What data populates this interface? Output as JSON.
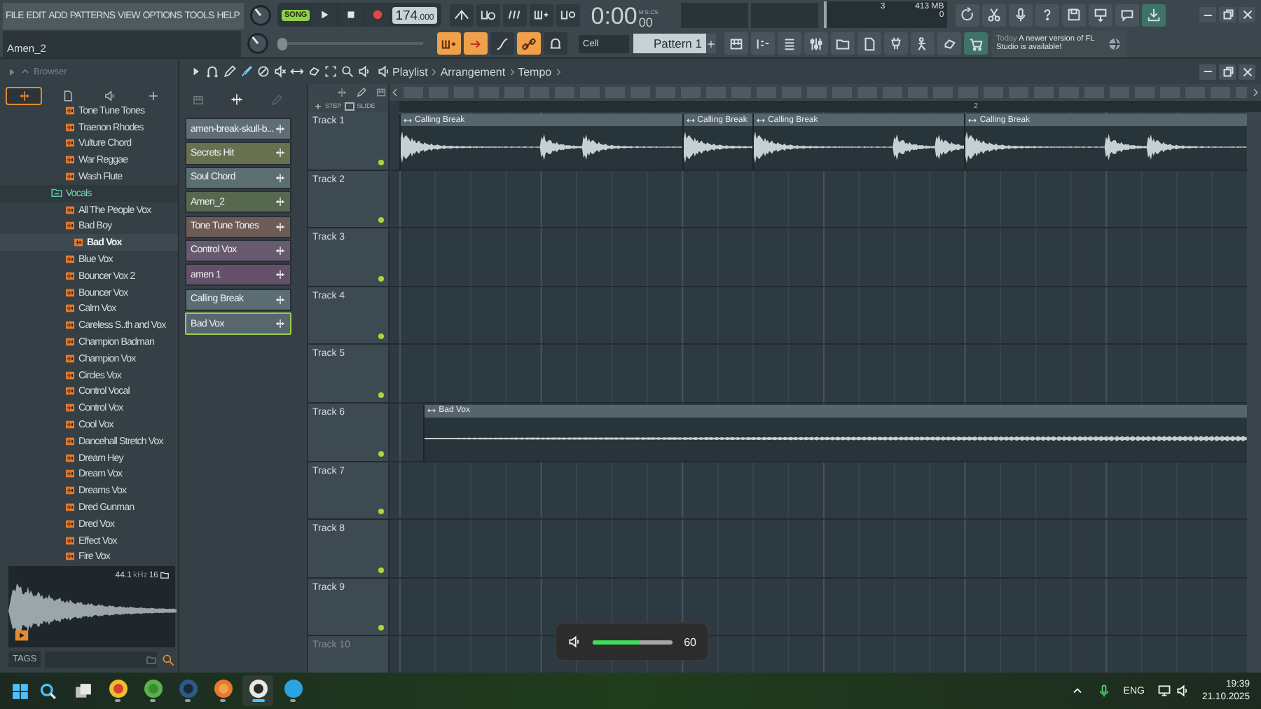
{
  "menu": [
    "FILE",
    "EDIT",
    "ADD",
    "PATTERNS",
    "VIEW",
    "OPTIONS",
    "TOOLS",
    "HELP"
  ],
  "hint": "Amen_2",
  "song_mode": {
    "label": "SONG",
    "on": true
  },
  "tempo": {
    "whole": "174",
    "fraction": ".000"
  },
  "clock": {
    "time": "0:00",
    "unit": "M:S:CS",
    "fraction": "00"
  },
  "cpu": {
    "cores": "3",
    "memory": "413 MB",
    "polyphony": "0"
  },
  "snap": "Cell",
  "pattern": "Pattern 1",
  "news": {
    "day": "Today",
    "text": "A newer version of FL Studio is available!"
  },
  "browser": {
    "title": "Browser",
    "tabs": [
      {
        "selected": true
      },
      {
        "selected": false
      },
      {
        "selected": false
      },
      {
        "selected": false
      }
    ],
    "items": [
      {
        "label": "Tone Tune Tones",
        "selected": false
      },
      {
        "label": "Traenon Rhodes",
        "selected": false
      },
      {
        "label": "Vulture Chord",
        "selected": false
      },
      {
        "label": "War Reggae",
        "selected": false
      },
      {
        "label": "Wash Flute",
        "selected": false
      }
    ],
    "folder": {
      "label": "Vocals",
      "expanded": true,
      "children": [
        {
          "label": "All The People Vox",
          "selected": false
        },
        {
          "label": "Bad Boy",
          "selected": false
        },
        {
          "label": "Bad Vox",
          "selected": true
        },
        {
          "label": "Blue Vox",
          "selected": false
        },
        {
          "label": "Bouncer Vox 2",
          "selected": false
        },
        {
          "label": "Bouncer Vox",
          "selected": false
        },
        {
          "label": "Calm Vox",
          "selected": false
        },
        {
          "label": "Careless S..th and Vox",
          "selected": false
        },
        {
          "label": "Champion Badman",
          "selected": false
        },
        {
          "label": "Champion Vox",
          "selected": false
        },
        {
          "label": "Circles Vox",
          "selected": false
        },
        {
          "label": "Control Vocal",
          "selected": false
        },
        {
          "label": "Control Vox",
          "selected": false
        },
        {
          "label": "Cool Vox",
          "selected": false
        },
        {
          "label": "Dancehall Stretch Vox",
          "selected": false
        },
        {
          "label": "Dream Hey",
          "selected": false
        },
        {
          "label": "Dream Vox",
          "selected": false
        },
        {
          "label": "Dreams Vox",
          "selected": false
        },
        {
          "label": "Dred Gunman",
          "selected": false
        },
        {
          "label": "Dred Vox",
          "selected": false
        },
        {
          "label": "Effect Vox",
          "selected": false
        },
        {
          "label": "Fire Vox",
          "selected": false
        }
      ]
    }
  },
  "preview": {
    "rate": "44.1",
    "rate_unit": "kHz",
    "bits": "16"
  },
  "tags_label": "TAGS",
  "channels": [
    {
      "name": "amen-break-skull-b...",
      "color": "#5f6d75",
      "selected": false
    },
    {
      "name": "Secrets Hit",
      "color": "#67704f",
      "selected": false
    },
    {
      "name": "Soul Chord",
      "color": "#5b6e72",
      "selected": false
    },
    {
      "name": "Amen_2",
      "color": "#56684f",
      "selected": false
    },
    {
      "name": "Tone Tune Tones",
      "color": "#6e5a56",
      "selected": false
    },
    {
      "name": "Control Vox",
      "color": "#675a6e",
      "selected": false
    },
    {
      "name": "amen 1",
      "color": "#645068",
      "selected": false
    },
    {
      "name": "Calling Break",
      "color": "#5a6c74",
      "selected": false
    },
    {
      "name": "Bad Vox",
      "color": "#586670",
      "selected": true
    }
  ],
  "playlist": {
    "breadcrumb": [
      "Playlist",
      "Arrangement",
      "Tempo"
    ],
    "step_label": "STEP",
    "slide_label": "SLIDE",
    "ruler": [
      {
        "label": "2"
      }
    ],
    "tracks": [
      {
        "name": "Track 1",
        "clips": [
          {
            "label": "Calling Break"
          },
          {
            "label": "Calling Break"
          },
          {
            "label": "Calling Break"
          },
          {
            "label": "Calling Break"
          }
        ]
      },
      {
        "name": "Track 2"
      },
      {
        "name": "Track 3"
      },
      {
        "name": "Track 4"
      },
      {
        "name": "Track 5"
      },
      {
        "name": "Track 6",
        "clips": [
          {
            "label": "Bad Vox"
          }
        ]
      },
      {
        "name": "Track 7"
      },
      {
        "name": "Track 8"
      },
      {
        "name": "Track 9"
      },
      {
        "name": "Track 10"
      }
    ]
  },
  "pitch_slider": {
    "level": 0
  },
  "volume": {
    "level": 0.6,
    "reading": "60"
  },
  "taskbar": {
    "apps": [
      {
        "active": false
      },
      {
        "active": false
      },
      {
        "active": false
      },
      {
        "active": false
      },
      {
        "active": true
      },
      {
        "active": false
      }
    ],
    "language": "ENG",
    "time": "19:39",
    "date": "21.10.2025"
  }
}
